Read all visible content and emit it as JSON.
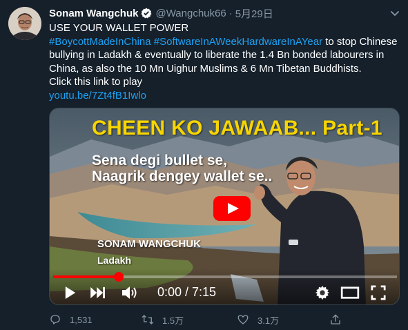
{
  "tweet": {
    "author_name": "Sonam Wangchuk",
    "handle": "@Wangchuk66",
    "separator": "·",
    "date": "5月29日",
    "line1": "USE YOUR WALLET POWER",
    "hashtag1": "#BoycottMadeInChina",
    "hashtag2": "#SoftwareInAWeekHardwareInAYear",
    "line2_rest": " to stop Chinese",
    "line3": "bullying in Ladakh & eventually to liberate the 1.4 Bn bonded labourers in",
    "line4": "China, as also the 10 Mn Uighur Muslims & 6 Mn Tibetan Buddhists.",
    "line5": "Click this link to play",
    "link": "youtu.be/7Zt4fB1Iwlo"
  },
  "video": {
    "title": "CHEEN KO JAWAAB... Part-1",
    "subtitle_line1": "Sena degi bullet se,",
    "subtitle_line2": "Naagrik dengey wallet se..",
    "speaker_name": "SONAM WANGCHUK",
    "speaker_place": "Ladakh",
    "time_display": "0:00 / 7:15",
    "progress_fraction": 0.19
  },
  "actions": {
    "replies": "1,531",
    "retweets": "1.5万",
    "likes": "3.1万"
  },
  "colors": {
    "background": "#15202b",
    "accent": "#1da1f2",
    "muted": "#8899a6",
    "video_title": "#f7d500",
    "youtube_red": "#ff0000"
  },
  "icons": [
    "verified-badge-icon",
    "chevron-down-icon",
    "play-icon",
    "next-icon",
    "volume-icon",
    "settings-icon",
    "theater-mode-icon",
    "fullscreen-icon",
    "reply-icon",
    "retweet-icon",
    "like-icon",
    "share-icon"
  ]
}
